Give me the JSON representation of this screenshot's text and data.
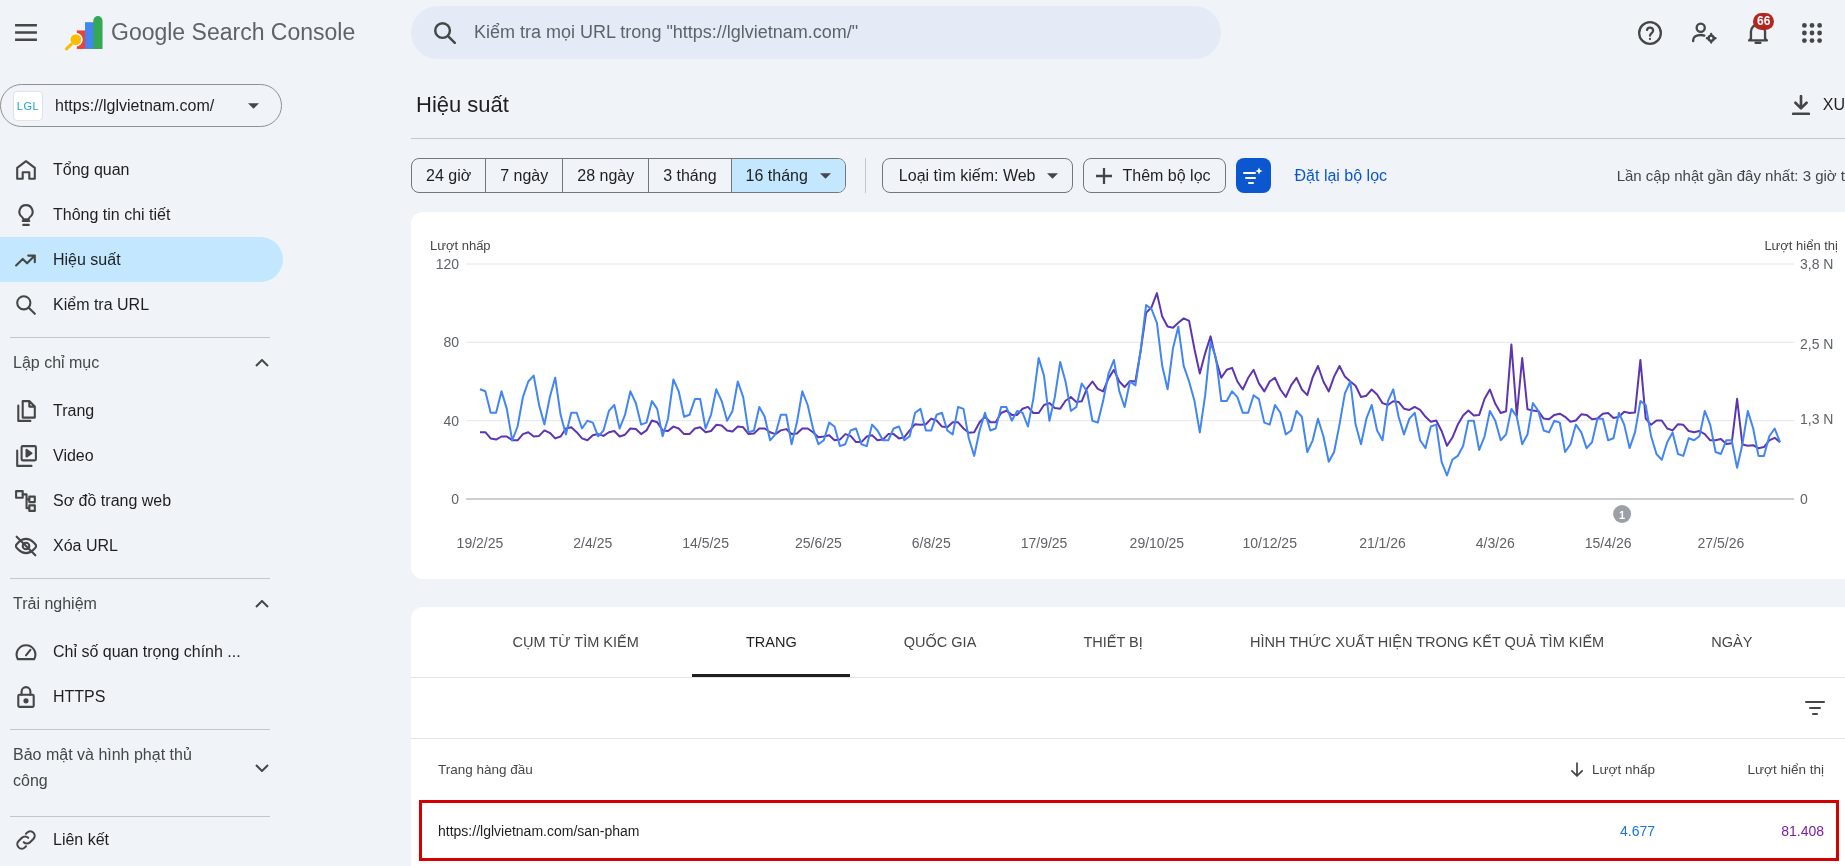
{
  "header": {
    "title": "Google Search Console",
    "search": {
      "placeholder": "Kiểm tra mọi URL trong \"https://lglvietnam.com/\""
    },
    "notification_count": "66"
  },
  "sidebar": {
    "property": {
      "logo_text": "LGL",
      "url": "https://lglvietnam.com/"
    },
    "sections": [
      {
        "items": [
          {
            "label": "Tổng quan",
            "selected": false
          },
          {
            "label": "Thông tin chi tiết",
            "selected": false
          },
          {
            "label": "Hiệu suất",
            "selected": true
          },
          {
            "label": "Kiểm tra URL",
            "selected": false
          }
        ]
      },
      {
        "title": "Lập chỉ mục",
        "expanded": true,
        "items": [
          {
            "label": "Trang",
            "selected": false
          },
          {
            "label": "Video",
            "selected": false
          },
          {
            "label": "Sơ đồ trang web",
            "selected": false
          },
          {
            "label": "Xóa URL",
            "selected": false
          }
        ]
      },
      {
        "title": "Trải nghiệm",
        "expanded": true,
        "items": [
          {
            "label": "Chỉ số quan trọng chính ...",
            "selected": false
          },
          {
            "label": "HTTPS",
            "selected": false
          }
        ]
      },
      {
        "title": "Bảo mật và hình phạt thủ công",
        "expanded": false
      },
      {
        "items": [
          {
            "label": "Liên kết",
            "selected": false
          }
        ]
      }
    ]
  },
  "page": {
    "title": "Hiệu suất",
    "export_label": "XU"
  },
  "filters": {
    "date_ranges": [
      {
        "label": "24 giờ",
        "kind": "preset",
        "selected": false
      },
      {
        "label": "7 ngày",
        "kind": "preset",
        "selected": false
      },
      {
        "label": "28 ngày",
        "kind": "preset",
        "selected": false
      },
      {
        "label": "3 tháng",
        "kind": "preset",
        "selected": false
      },
      {
        "label": "16 tháng",
        "kind": "menu",
        "selected": true
      }
    ],
    "search_type": "Loại tìm kiếm: Web",
    "add_filter": "Thêm bộ lọc",
    "reset": "Đặt lại bộ lọc",
    "last_updated": "Lần cập nhật gần đây nhất: 3 giờ t"
  },
  "chart": {
    "chart_data": {
      "type": "line",
      "ylabel": "Lượt nhấp",
      "y2label": "Lượt hiển thị",
      "categories": [
        "19/2/25",
        null,
        null,
        null,
        null,
        null,
        null,
        null,
        null,
        null,
        null,
        null,
        null,
        null,
        null,
        null,
        null,
        null,
        null,
        null,
        null,
        "2/4/25",
        null,
        null,
        null,
        null,
        null,
        null,
        null,
        null,
        null,
        null,
        null,
        null,
        null,
        null,
        null,
        null,
        null,
        null,
        null,
        null,
        "14/5/25",
        null,
        null,
        null,
        null,
        null,
        null,
        null,
        null,
        null,
        null,
        null,
        null,
        null,
        null,
        null,
        null,
        null,
        null,
        null,
        null,
        "25/6/25",
        null,
        null,
        null,
        null,
        null,
        null,
        null,
        null,
        null,
        null,
        null,
        null,
        null,
        null,
        null,
        null,
        null,
        null,
        null,
        null,
        "6/8/25",
        null,
        null,
        null,
        null,
        null,
        null,
        null,
        null,
        null,
        null,
        null,
        null,
        null,
        null,
        null,
        null,
        null,
        null,
        null,
        null,
        "17/9/25",
        null,
        null,
        null,
        null,
        null,
        null,
        null,
        null,
        null,
        null,
        null,
        null,
        null,
        null,
        null,
        null,
        null,
        null,
        null,
        null,
        "29/10/25",
        null,
        null,
        null,
        null,
        null,
        null,
        null,
        null,
        null,
        null,
        null,
        null,
        null,
        null,
        null,
        null,
        null,
        null,
        null,
        null,
        "10/12/25",
        null,
        null,
        null,
        null,
        null,
        null,
        null,
        null,
        null,
        null,
        null,
        null,
        null,
        null,
        null,
        null,
        null,
        null,
        null,
        null,
        "21/1/26",
        null,
        null,
        null,
        null,
        null,
        null,
        null,
        null,
        null,
        null,
        null,
        null,
        null,
        null,
        null,
        null,
        null,
        null,
        null,
        null,
        "4/3/26",
        null,
        null,
        null,
        null,
        null,
        null,
        null,
        null,
        null,
        null,
        null,
        null,
        null,
        null,
        null,
        null,
        null,
        null,
        null,
        null,
        "15/4/26",
        null,
        null,
        null,
        null,
        null,
        null,
        null,
        null,
        null,
        null,
        null,
        null,
        null,
        null,
        null,
        null,
        null,
        null,
        null,
        null,
        "27/5/26",
        null,
        null,
        null,
        null,
        null,
        null,
        null,
        null,
        null,
        null,
        null
      ],
      "ylim": [
        0,
        120
      ],
      "y2lim": [
        0,
        3.8
      ],
      "yticks": [
        0,
        40,
        80,
        120
      ],
      "y2ticks": [
        {
          "value": 0,
          "label": "0"
        },
        {
          "value": 1.3,
          "label": "1,3 N"
        },
        {
          "value": 2.5,
          "label": "2,5 N"
        },
        {
          "value": 3.8,
          "label": "3,8 N"
        }
      ],
      "series": [
        {
          "color": "#4285f4",
          "values": [
            56,
            55,
            44,
            44,
            55,
            46,
            30,
            37,
            52,
            60,
            63,
            48,
            38,
            52,
            62,
            43,
            33,
            44,
            44,
            36,
            40,
            39,
            32,
            35,
            45,
            48,
            36,
            43,
            55,
            49,
            38,
            39,
            50,
            46,
            32,
            41,
            61,
            55,
            42,
            43,
            51,
            51,
            36,
            43,
            56,
            50,
            40,
            45,
            60,
            52,
            34,
            35,
            47,
            42,
            30,
            33,
            43,
            43,
            28,
            39,
            55,
            48,
            36,
            28,
            30,
            39,
            37,
            27,
            28,
            35,
            36,
            28,
            27,
            38,
            35,
            30,
            30,
            36,
            37,
            30,
            32,
            44,
            46,
            35,
            35,
            43,
            44,
            35,
            33,
            47,
            46,
            31,
            22,
            35,
            44,
            35,
            36,
            47,
            47,
            40,
            45,
            44,
            37,
            51,
            72,
            63,
            40,
            52,
            70,
            60,
            45,
            47,
            59,
            55,
            40,
            39,
            50,
            64,
            71,
            55,
            47,
            60,
            58,
            76,
            99,
            97,
            90,
            68,
            56,
            77,
            88,
            68,
            60,
            50,
            34,
            53,
            80,
            72,
            50,
            50,
            55,
            52,
            44,
            44,
            53,
            51,
            39,
            38,
            48,
            44,
            33,
            35,
            45,
            42,
            24,
            30,
            41,
            32,
            19,
            24,
            38,
            54,
            60,
            38,
            28,
            41,
            48,
            35,
            30,
            50,
            56,
            42,
            33,
            41,
            44,
            30,
            26,
            37,
            38,
            19,
            12,
            20,
            22,
            27,
            40,
            40,
            25,
            32,
            45,
            40,
            30,
            33,
            46,
            42,
            28,
            33,
            49,
            45,
            35,
            34,
            40,
            39,
            24,
            28,
            38,
            34,
            26,
            29,
            41,
            41,
            30,
            31,
            44,
            38,
            26,
            34,
            50,
            48,
            32,
            23,
            20,
            29,
            34,
            23,
            22,
            31,
            30,
            32,
            45,
            38,
            24,
            23,
            30,
            30,
            16,
            28,
            45,
            36,
            22,
            22,
            32,
            36,
            29
          ]
        },
        {
          "color": "#5e35b1",
          "axis": "y2",
          "values": [
            1.08,
            1.08,
            0.98,
            0.96,
            1.01,
            1.01,
            0.95,
            0.95,
            1.05,
            1.08,
            1.01,
            1.02,
            1.11,
            1.07,
            0.98,
            1.01,
            1.14,
            1.16,
            1.08,
            0.98,
            0.95,
            1.03,
            1.05,
            1.02,
            1.08,
            1.1,
            1.01,
            1.04,
            1.14,
            1.13,
            1.05,
            1.11,
            1.27,
            1.24,
            1.11,
            1.1,
            1.17,
            1.14,
            1.05,
            1.05,
            1.14,
            1.16,
            1.08,
            1.1,
            1.2,
            1.19,
            1.11,
            1.09,
            1.17,
            1.16,
            1.05,
            1.06,
            1.14,
            1.14,
            1.08,
            1.05,
            1.11,
            1.13,
            1.05,
            1.06,
            1.14,
            1.14,
            1.08,
            1.0,
            1.01,
            1.03,
            0.95,
            0.96,
            1.05,
            1.02,
            0.92,
            0.92,
            1.01,
            1.03,
            0.95,
            0.96,
            1.05,
            1.05,
            0.98,
            1.0,
            1.11,
            1.21,
            1.2,
            1.21,
            1.3,
            1.27,
            1.17,
            1.16,
            1.24,
            1.24,
            1.14,
            1.07,
            1.08,
            1.24,
            1.33,
            1.24,
            1.24,
            1.39,
            1.43,
            1.36,
            1.36,
            1.46,
            1.49,
            1.39,
            1.39,
            1.52,
            1.55,
            1.47,
            1.46,
            1.59,
            1.65,
            1.57,
            1.58,
            1.79,
            1.9,
            1.78,
            1.74,
            1.95,
            2.09,
            1.9,
            1.81,
            1.91,
            1.9,
            2.4,
            3.01,
            3.1,
            3.33,
            2.95,
            2.79,
            2.77,
            2.85,
            2.92,
            2.88,
            2.42,
            2.03,
            2.36,
            2.63,
            2.25,
            1.96,
            2.09,
            2.12,
            1.9,
            1.77,
            1.96,
            2.09,
            1.87,
            1.74,
            1.9,
            1.96,
            1.77,
            1.65,
            1.84,
            1.96,
            1.77,
            1.68,
            1.97,
            2.15,
            1.9,
            1.74,
            1.98,
            2.15,
            1.98,
            1.9,
            1.83,
            1.65,
            1.67,
            1.77,
            1.69,
            1.55,
            1.52,
            1.58,
            1.57,
            1.46,
            1.44,
            1.49,
            1.44,
            1.33,
            1.25,
            1.27,
            1.1,
            0.86,
            0.99,
            1.2,
            1.35,
            1.43,
            1.35,
            1.36,
            1.62,
            1.77,
            1.54,
            1.39,
            1.42,
            2.5,
            1.35,
            2.28,
            1.45,
            1.43,
            1.42,
            1.3,
            1.29,
            1.36,
            1.38,
            1.33,
            1.25,
            1.27,
            1.37,
            1.36,
            1.29,
            1.3,
            1.38,
            1.39,
            1.31,
            1.33,
            1.41,
            1.39,
            1.4,
            2.25,
            1.3,
            1.2,
            1.27,
            1.27,
            1.14,
            1.11,
            1.21,
            1.2,
            1.1,
            1.08,
            1.1,
            1.05,
            0.95,
            0.95,
            0.97,
            0.89,
            0.9,
            1.62,
            0.88,
            0.86,
            0.87,
            0.82,
            0.84,
            0.95,
            0.99,
            0.92
          ]
        }
      ],
      "annotations": [
        "1"
      ]
    }
  },
  "report_tabs": [
    {
      "label": "CỤM TỪ TÌM KIẾM",
      "selected": false
    },
    {
      "label": "TRANG",
      "selected": true
    },
    {
      "label": "QUỐC GIA",
      "selected": false
    },
    {
      "label": "THIẾT BỊ",
      "selected": false
    },
    {
      "label": "HÌNH THỨC XUẤT HIỆN TRONG KẾT QUẢ TÌM KIẾM",
      "selected": false
    },
    {
      "label": "NGÀY",
      "selected": false
    }
  ],
  "table": {
    "columns": [
      {
        "label": "Trang hàng đầu",
        "sorted": false
      },
      {
        "label": "Lượt nhấp",
        "sorted": true,
        "color": "#1a73e8"
      },
      {
        "label": "Lượt hiển thị",
        "sorted": false,
        "color": "#7b1fa2"
      }
    ],
    "rows": [
      {
        "cells": [
          "https://lglvietnam.com/san-pham",
          "4.677",
          "81.408"
        ],
        "highlighted": true
      }
    ]
  }
}
